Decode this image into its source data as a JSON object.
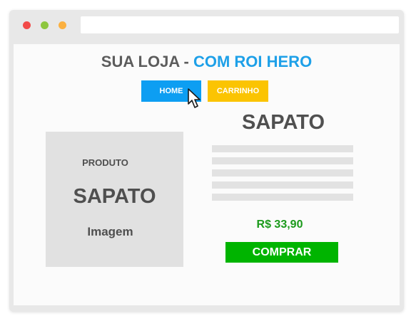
{
  "store_header": {
    "title_prefix": "SUA LOJA - ",
    "title_highlight": "COM ROI HERO"
  },
  "nav": {
    "home_label": "HOME",
    "cart_label": "CARRINHO"
  },
  "product_image": {
    "caption_top": "PRODUTO",
    "caption_main": "SAPATO",
    "caption_bottom": "Imagem"
  },
  "product": {
    "name": "SAPATO",
    "price": "R$ 33,90",
    "buy_label": "COMPRAR"
  },
  "colors": {
    "window_dot_close": "#f24a48",
    "window_dot_maximize": "#8dc63f",
    "window_dot_minimize": "#fbb040",
    "title_accent": "#1ea0e8",
    "home_button": "#0d9ef2",
    "cart_button": "#fbc402",
    "price_text": "#1b9a1b",
    "buy_button": "#00b400"
  },
  "icons": {
    "pointer": "mouse-pointer-icon"
  }
}
